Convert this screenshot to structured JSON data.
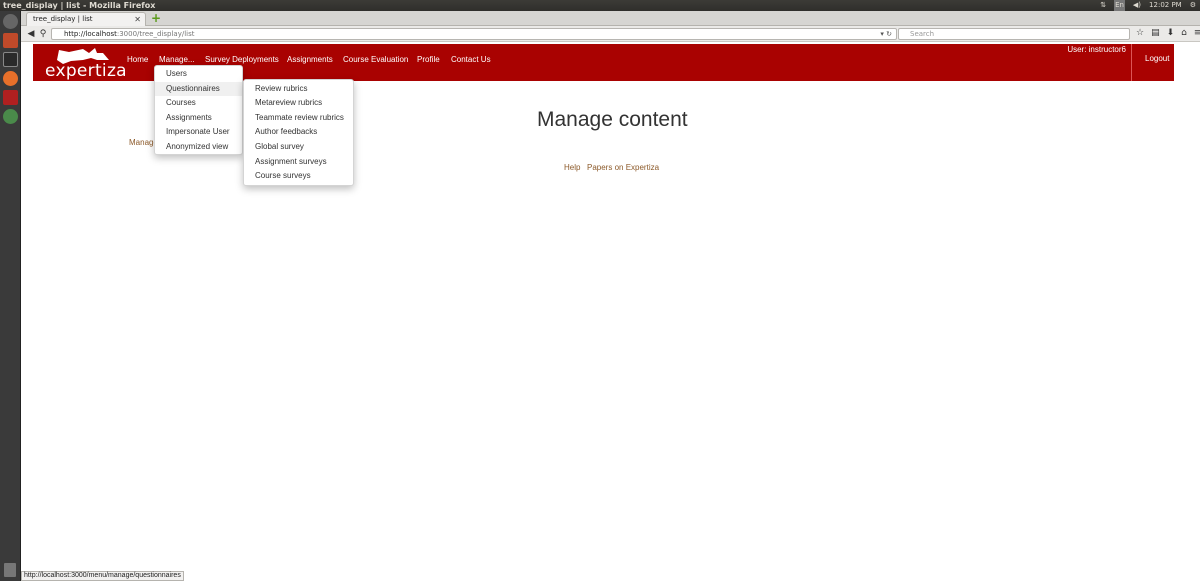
{
  "os": {
    "window_title": "tree_display | list - Mozilla Firefox",
    "time": "12:02 PM",
    "lang": "En"
  },
  "browser": {
    "tab_title": "tree_display | list",
    "url_host": "http://localhost",
    "url_rest": ":3000/tree_display/list",
    "search_placeholder": "Search"
  },
  "header": {
    "logo": "expertiza",
    "menu": [
      "Home",
      "Manage...",
      "Survey Deployments",
      "Assignments",
      "Course Evaluation",
      "Profile",
      "Contact Us"
    ],
    "user": "User: instructor6",
    "logout": "Logout"
  },
  "manage_menu": [
    "Users",
    "Questionnaires",
    "Courses",
    "Assignments",
    "Impersonate User",
    "Anonymized view"
  ],
  "questionnaires_menu": [
    "Review rubrics",
    "Metareview rubrics",
    "Teammate review rubrics",
    "Author feedbacks",
    "Global survey",
    "Assignment surveys",
    "Course surveys"
  ],
  "main": {
    "title": "Manage content",
    "manage_link": "Manage",
    "help": "Help",
    "papers": "Papers on Expertiza"
  },
  "status_url": "http://localhost:3000/menu/manage/questionnaires"
}
